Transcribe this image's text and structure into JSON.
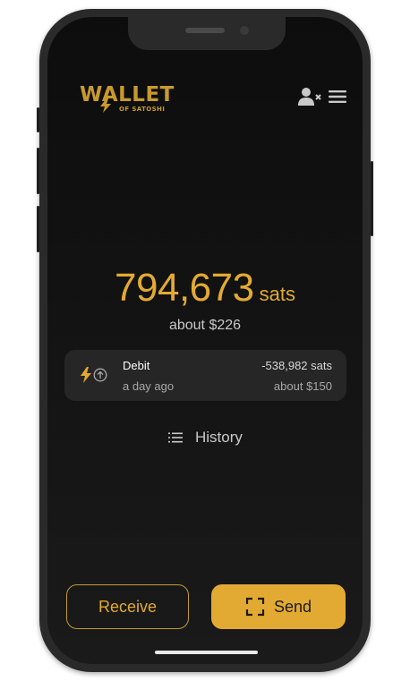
{
  "header": {
    "logo_main": "WALLET",
    "logo_sub": "OF SATOSHI",
    "icons": {
      "account": "user-x-icon",
      "menu": "hamburger-menu-icon"
    }
  },
  "balance": {
    "amount": "794,673",
    "unit": "sats",
    "fiat": "about $226"
  },
  "transactions": [
    {
      "type": "Debit",
      "time": "a day ago",
      "amount": "-538,982 sats",
      "fiat": "about $150",
      "icons": [
        "lightning-icon",
        "arrow-up-circle-icon"
      ]
    }
  ],
  "history": {
    "label": "History",
    "icon": "list-icon"
  },
  "actions": {
    "receive_label": "Receive",
    "send_label": "Send",
    "send_icon": "scan-frame-icon"
  },
  "colors": {
    "accent": "#e3aa33",
    "background": "#111111",
    "card": "#262626",
    "text_secondary": "#a8a8a8"
  }
}
